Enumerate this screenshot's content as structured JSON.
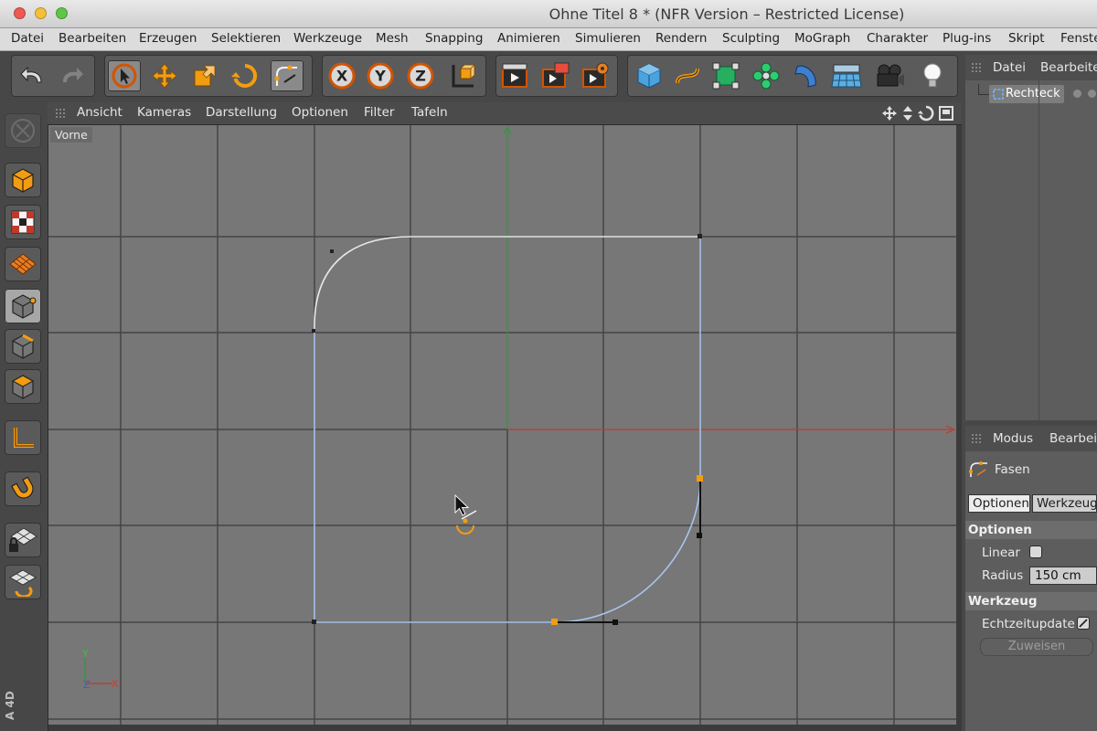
{
  "window": {
    "title": "Ohne Titel 8 * (NFR Version – Restricted License)"
  },
  "menu": [
    "Datei",
    "Bearbeiten",
    "Erzeugen",
    "Selektieren",
    "Werkzeuge",
    "Mesh",
    "Snapping",
    "Animieren",
    "Simulieren",
    "Rendern",
    "Sculpting",
    "MoGraph",
    "Charakter",
    "Plug-ins",
    "Skript",
    "Fenster"
  ],
  "toolbar": {
    "axis_x": "X",
    "axis_y": "Y",
    "axis_z": "Z"
  },
  "viewport": {
    "menu": [
      "Ansicht",
      "Kameras",
      "Darstellung",
      "Optionen",
      "Filter",
      "Tafeln"
    ],
    "view_name": "Vorne",
    "gizmo": {
      "y": "Y",
      "z": "Z",
      "x": "X"
    },
    "watermark": "A 4D"
  },
  "objects": {
    "menu": [
      "Datei",
      "Bearbeiten"
    ],
    "items": [
      "Rechteck"
    ]
  },
  "attributes": {
    "menu": [
      "Modus",
      "Bearbeiten"
    ],
    "tool_name": "Fasen",
    "tabs": [
      "Optionen",
      "Werkzeug"
    ],
    "options_title": "Optionen",
    "linear_label": "Linear",
    "radius_label": "Radius",
    "radius_value": "150 cm",
    "tool_title": "Werkzeug",
    "realtime_label": "Echtzeitupdate",
    "apply_label": "Zuweisen"
  },
  "colors": {
    "accent": "#f39c12",
    "spline": "#a9c4ee",
    "axis_x": "#c0392b",
    "axis_y": "#2e9a3a"
  }
}
